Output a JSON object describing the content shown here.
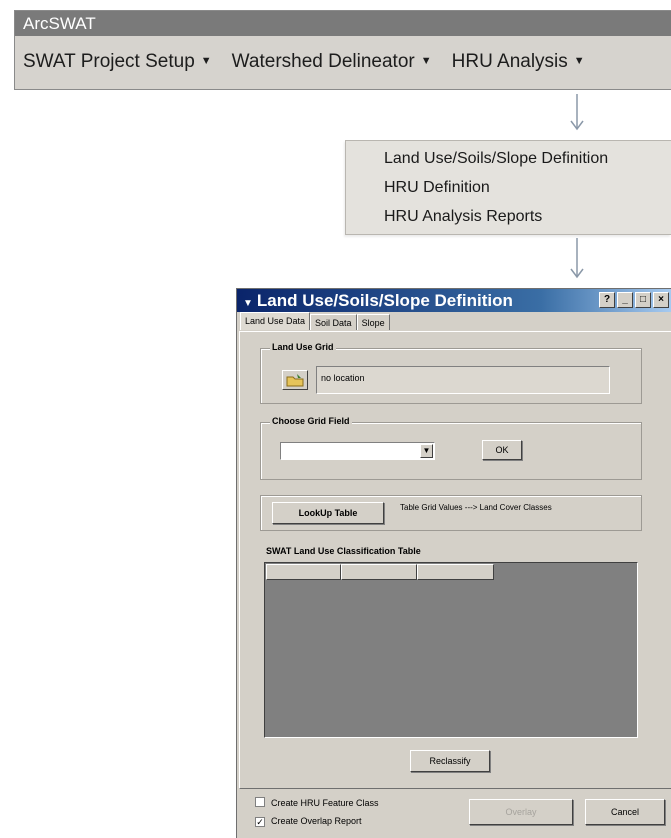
{
  "toolbar": {
    "title": "ArcSWAT",
    "menus": [
      {
        "label": "SWAT Project Setup"
      },
      {
        "label": "Watershed Delineator"
      },
      {
        "label": "HRU Analysis"
      }
    ]
  },
  "dropdown": {
    "items": [
      {
        "label": "Land Use/Soils/Slope Definition"
      },
      {
        "label": "HRU Definition"
      },
      {
        "label": "HRU Analysis Reports"
      }
    ]
  },
  "dialog": {
    "title": "Land Use/Soils/Slope Definition",
    "tabs": [
      "Land Use Data",
      "Soil Data",
      "Slope"
    ],
    "land_use_grid": {
      "label": "Land Use Grid",
      "location_value": "no location"
    },
    "grid_field": {
      "label": "Choose Grid Field",
      "selected": "",
      "ok_label": "OK"
    },
    "lookup": {
      "button_label": "LookUp Table",
      "note": "Table Grid Values ---> Land Cover Classes"
    },
    "classification": {
      "label": "SWAT Land Use Classification Table",
      "columns": [
        "",
        "",
        ""
      ]
    },
    "reclassify_label": "Reclassify",
    "options": [
      {
        "label": "Create HRU Feature Class",
        "checked": false
      },
      {
        "label": "Create Overlap Report",
        "checked": true
      }
    ],
    "overlay_label": "Overlay",
    "cancel_label": "Cancel"
  }
}
